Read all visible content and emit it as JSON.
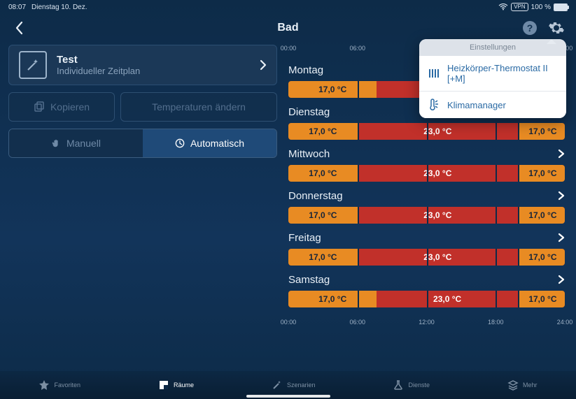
{
  "status": {
    "time": "08:07",
    "date": "Dienstag 10. Dez.",
    "vpn": "VPN",
    "battery_pct": "100 %"
  },
  "header": {
    "title": "Bad"
  },
  "plan": {
    "name": "Test",
    "subtitle": "Individueller Zeitplan"
  },
  "buttons": {
    "copy": "Kopieren",
    "temps": "Temperaturen ändern",
    "manual": "Manuell",
    "auto": "Automatisch"
  },
  "axis": {
    "t0": "00:00",
    "t6": "06:00",
    "t12": "12:00",
    "t18": "18:00",
    "t24": "24:00"
  },
  "schedule": {
    "days": [
      {
        "name": "Montag",
        "segs": [
          {
            "t": "o",
            "from": 0,
            "to": 32,
            "label": "17,0 °C"
          },
          {
            "t": "r",
            "from": 32,
            "to": 100,
            "label": ""
          }
        ]
      },
      {
        "name": "Dienstag",
        "segs": [
          {
            "t": "o",
            "from": 0,
            "to": 25,
            "label": "17,0 °C"
          },
          {
            "t": "r",
            "from": 25,
            "to": 83,
            "label": "23,0 °C"
          },
          {
            "t": "o",
            "from": 83,
            "to": 100,
            "label": "17,0 °C"
          }
        ]
      },
      {
        "name": "Mittwoch",
        "segs": [
          {
            "t": "o",
            "from": 0,
            "to": 25,
            "label": "17,0 °C"
          },
          {
            "t": "r",
            "from": 25,
            "to": 83,
            "label": "23,0 °C"
          },
          {
            "t": "o",
            "from": 83,
            "to": 100,
            "label": "17,0 °C"
          }
        ]
      },
      {
        "name": "Donnerstag",
        "segs": [
          {
            "t": "o",
            "from": 0,
            "to": 25,
            "label": "17,0 °C"
          },
          {
            "t": "r",
            "from": 25,
            "to": 83,
            "label": "23,0 °C"
          },
          {
            "t": "o",
            "from": 83,
            "to": 100,
            "label": "17,0 °C"
          }
        ]
      },
      {
        "name": "Freitag",
        "segs": [
          {
            "t": "o",
            "from": 0,
            "to": 25,
            "label": "17,0 °C"
          },
          {
            "t": "r",
            "from": 25,
            "to": 83,
            "label": "23,0 °C"
          },
          {
            "t": "o",
            "from": 83,
            "to": 100,
            "label": "17,0 °C"
          }
        ]
      },
      {
        "name": "Samstag",
        "segs": [
          {
            "t": "o",
            "from": 0,
            "to": 32,
            "label": "17,0 °C"
          },
          {
            "t": "r",
            "from": 32,
            "to": 83,
            "label": "23,0 °C"
          },
          {
            "t": "o",
            "from": 83,
            "to": 100,
            "label": "17,0 °C"
          }
        ]
      }
    ]
  },
  "popover": {
    "title": "Einstellungen",
    "item1": "Heizkörper-Thermostat II [+M]",
    "item2": "Klimamanager"
  },
  "tabs": {
    "fav": "Favoriten",
    "rooms": "Räume",
    "scen": "Szenarien",
    "serv": "Dienste",
    "more": "Mehr"
  }
}
